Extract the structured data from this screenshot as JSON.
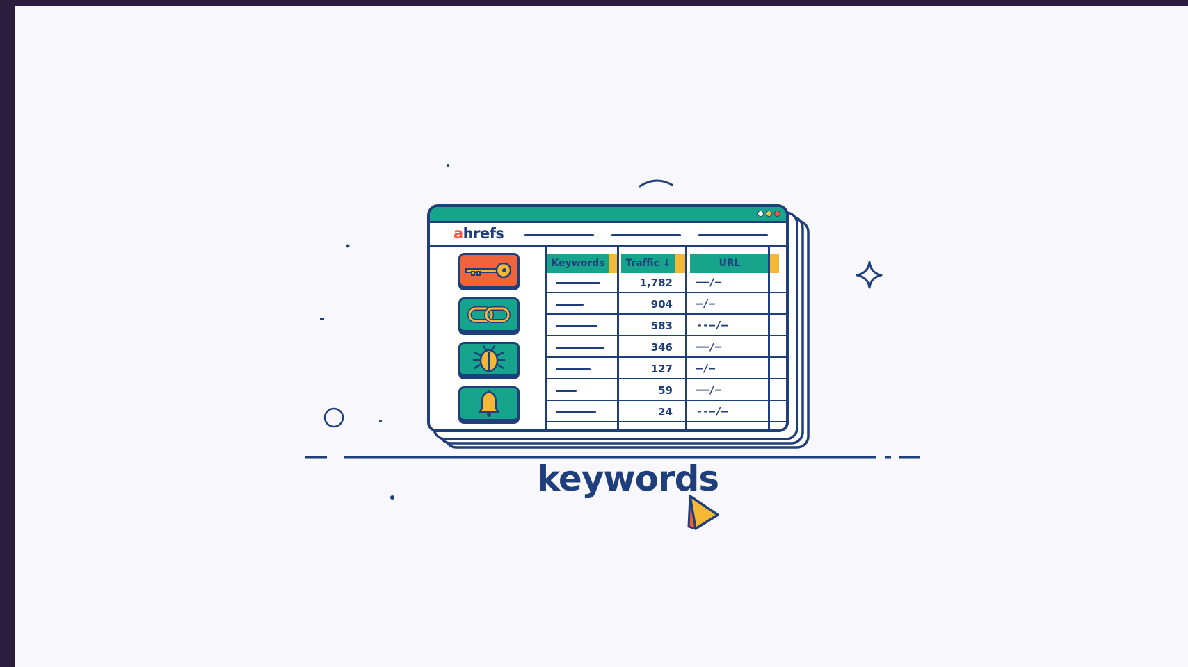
{
  "brand": {
    "prefix": "a",
    "rest": "hrefs"
  },
  "colors": {
    "navy": "#1e3f7c",
    "teal": "#16a58c",
    "orange": "#f0643c",
    "yellow": "#f5b834",
    "background": "#f8f7fc"
  },
  "tools": [
    {
      "icon": "key-icon",
      "color": "orange"
    },
    {
      "icon": "link-icon",
      "color": "teal"
    },
    {
      "icon": "bug-icon",
      "color": "teal"
    },
    {
      "icon": "bell-icon",
      "color": "teal"
    }
  ],
  "table": {
    "headers": [
      "Keywords",
      "Traffic ↓",
      "URL"
    ],
    "rows": [
      {
        "traffic": "1,782",
        "url": "——/—"
      },
      {
        "traffic": "904",
        "url": "—/—"
      },
      {
        "traffic": "583",
        "url": "--—/—"
      },
      {
        "traffic": "346",
        "url": "——/—"
      },
      {
        "traffic": "127",
        "url": "—/—"
      },
      {
        "traffic": "59",
        "url": "——/—"
      },
      {
        "traffic": "24",
        "url": "--—/—"
      }
    ]
  },
  "caption": "keywords"
}
